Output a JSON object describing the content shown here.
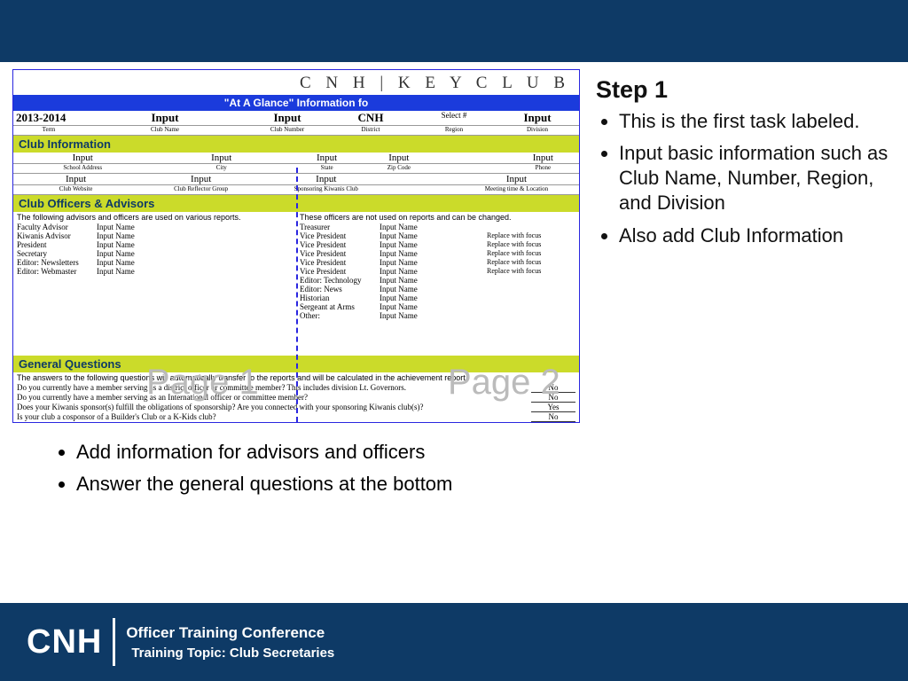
{
  "form": {
    "brand": "C N H | K E Y  C L U B",
    "blue_title": "\"At A Glance\" Information fo",
    "top_row": {
      "term": "2013-2014",
      "labels": [
        "Term",
        "Club Name",
        "Club Number",
        "District",
        "Region",
        "Division"
      ],
      "vals": [
        "Input",
        "Input",
        "CNH",
        "Select #",
        "Input"
      ]
    },
    "section1": "Club Information",
    "ci_row1_vals": [
      "Input",
      "Input",
      "Input",
      "Input",
      "",
      "Input"
    ],
    "ci_row1_labels": [
      "School Address",
      "City",
      "State",
      "Zip Code",
      "",
      "Phone"
    ],
    "ci_row2_vals": [
      "Input",
      "Input",
      "Input",
      "",
      "Input"
    ],
    "ci_row2_labels": [
      "Club Website",
      "Club Reflector Group",
      "Sponsoring Kiwanis Club",
      "",
      "Meeting time & Location"
    ],
    "section2": "Club Officers & Advisors",
    "note_left": "The following advisors and officers are used on various reports.",
    "note_right": "These officers are not used on reports and can be changed.",
    "officers_left": [
      {
        "role": "Faculty Advisor",
        "name": "Input Name"
      },
      {
        "role": "Kiwanis Advisor",
        "name": "Input Name"
      },
      {
        "role": "President",
        "name": "Input Name"
      },
      {
        "role": "Secretary",
        "name": "Input Name"
      },
      {
        "role": "Editor: Newsletters",
        "name": "Input Name"
      },
      {
        "role": "Editor: Webmaster",
        "name": "Input Name"
      }
    ],
    "officers_right": [
      {
        "role": "Treasurer",
        "name": "Input Name",
        "extra": ""
      },
      {
        "role": "Vice President",
        "name": "Input Name",
        "extra": "Replace with focus"
      },
      {
        "role": "Vice President",
        "name": "Input Name",
        "extra": "Replace with focus"
      },
      {
        "role": "Vice President",
        "name": "Input Name",
        "extra": "Replace with focus"
      },
      {
        "role": "Vice President",
        "name": "Input Name",
        "extra": "Replace with focus"
      },
      {
        "role": "Vice President",
        "name": "Input Name",
        "extra": "Replace with focus"
      },
      {
        "role": "Editor: Technology",
        "name": "Input Name",
        "extra": ""
      },
      {
        "role": "Editor: News",
        "name": "Input Name",
        "extra": ""
      },
      {
        "role": "Historian",
        "name": "Input Name",
        "extra": ""
      },
      {
        "role": "Sergeant at Arms",
        "name": "Input Name",
        "extra": ""
      },
      {
        "role": "Other:",
        "name": "Input Name",
        "extra": ""
      }
    ],
    "wm1": "Page 1",
    "wm2": "Page 2",
    "section3": "General Questions",
    "gq_intro": "The answers to the following questions will automatically transfer to the reports and will be calculated in the achievement report.",
    "gq": [
      {
        "q": "Do you currently have a member serving as a district officer or committee member? This includes division Lt. Governors.",
        "a": "No"
      },
      {
        "q": "Do you currently have a member serving as an International officer or committee member?",
        "a": "No"
      },
      {
        "q": "Does your Kiwanis sponsor(s) fulfill the obligations of sponsorship? Are you connected with your sponsoring Kiwanis club(s)?",
        "a": "Yes"
      },
      {
        "q": "Is your club a cosponsor of a Builder's Club or a K-Kids club?",
        "a": "No"
      }
    ]
  },
  "side": {
    "heading": "Step 1",
    "bullets": [
      "This is the first task labeled.",
      "Input basic information such as Club Name, Number, Region, and Division",
      "Also add Club Information"
    ]
  },
  "below_bullets": [
    "Add information for advisors and officers",
    "Answer the general questions at the bottom"
  ],
  "footer": {
    "logo": "CNH",
    "line1": "Officer Training Conference",
    "line2": "Training Topic: Club Secretaries"
  }
}
